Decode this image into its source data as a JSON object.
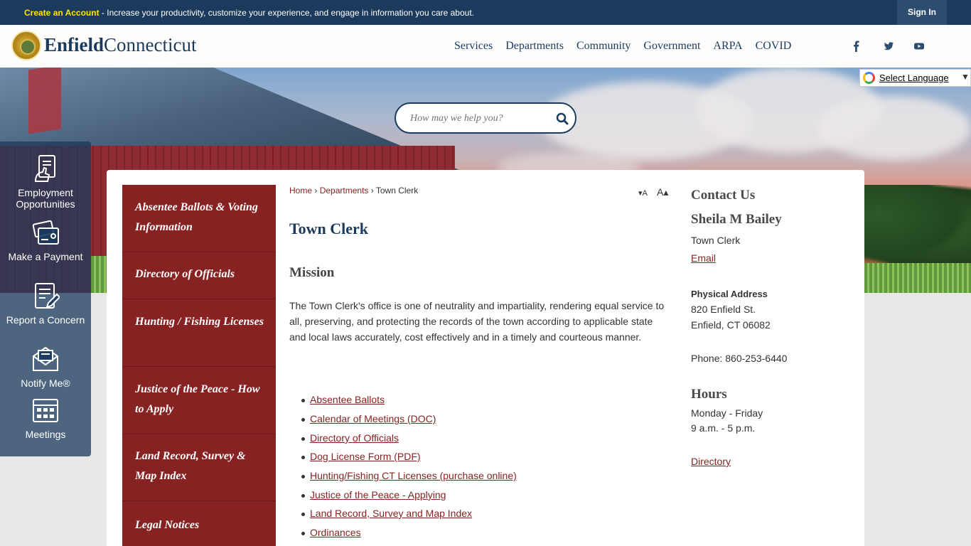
{
  "topbar": {
    "create_account": "Create an Account",
    "message": " - Increase your productivity, customize your experience, and engage in information you care about.",
    "sign_in": "Sign In"
  },
  "header": {
    "logo_bold": "Enfield",
    "logo_rest": "Connecticut",
    "nav": [
      "Services",
      "Departments",
      "Community",
      "Government",
      "ARPA",
      "COVID"
    ],
    "social": [
      "facebook-icon",
      "twitter-icon",
      "youtube-icon"
    ]
  },
  "search": {
    "placeholder": "How may we help you?"
  },
  "translate": {
    "label": "Select Language",
    "arrow": "▼"
  },
  "quick_links": [
    {
      "label": "Employment Opportunities",
      "icon": "employment-icon"
    },
    {
      "label": "Make a Payment",
      "icon": "payment-icon"
    },
    {
      "label": "Report a Concern",
      "icon": "report-icon"
    },
    {
      "label": "Notify Me®",
      "icon": "notify-icon"
    },
    {
      "label": "Meetings",
      "icon": "meetings-icon"
    }
  ],
  "sidenav": [
    "Absentee Ballots & Voting Information",
    "Directory of Officials",
    "Hunting / Fishing Licenses",
    "Justice of the Peace - How to Apply",
    "Land Record, Survey & Map Index",
    "Legal Notices"
  ],
  "breadcrumb": {
    "home": "Home",
    "sep": "›",
    "departments": "Departments",
    "current": "Town Clerk"
  },
  "font_resize": {
    "decrease": "▾A",
    "increase": "A▴"
  },
  "page": {
    "title": "Town Clerk",
    "mission_heading": "Mission",
    "mission_text": "The Town Clerk's office is one of neutrality and impartiality, rendering equal service to all, preserving, and protecting the records of the town according to applicable state and local laws accurately, cost effectively and in a timely and courteous manner.",
    "links": [
      "Absentee Ballots",
      "Calendar of Meetings (DOC)",
      "Directory of Officials",
      "Dog License Form (PDF)",
      "Hunting/Fishing CT Licenses (purchase online)",
      "Justice of the Peace - Applying",
      "Land Record, Survey and Map Index",
      "Ordinances"
    ]
  },
  "contact": {
    "heading": "Contact Us",
    "name": "Sheila M Bailey",
    "title": "Town Clerk",
    "email": "Email",
    "address_label": "Physical Address",
    "address1": "820 Enfield St.",
    "address2": "Enfield, CT 06082",
    "phone": "Phone: 860-253-6440",
    "hours_heading": "Hours",
    "hours1": "Monday - Friday",
    "hours2": "9 a.m. - 5 p.m.",
    "directory": "Directory"
  },
  "colors": {
    "navy": "#1b3a5c",
    "maroon": "#862322",
    "accent_yellow": "#ffe600"
  }
}
